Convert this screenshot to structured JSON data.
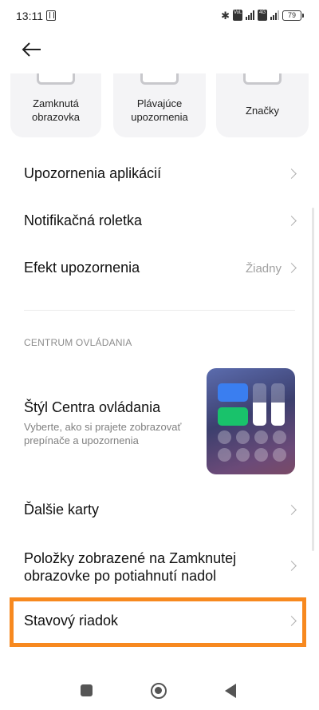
{
  "status_bar": {
    "time": "13:11",
    "sim1_badge": "VoLTE",
    "sim2_badge": "4G",
    "battery": "79",
    "icons": [
      "nfc-icon",
      "bluetooth-icon",
      "signal-icon",
      "battery-icon"
    ]
  },
  "cards": [
    {
      "label": "Zamknutá obrazovka"
    },
    {
      "label": "Plávajúce upozornenia"
    },
    {
      "label": "Značky"
    }
  ],
  "settings": {
    "app_notifications": "Upozornenia aplikácií",
    "notification_shade": "Notifikačná roletka",
    "notification_effect": "Efekt upozornenia",
    "notification_effect_value": "Žiadny"
  },
  "control_center": {
    "section_header": "CENTRUM OVLÁDANIA",
    "style_title": "Štýl Centra ovládania",
    "style_subtitle": "Vyberte, ako si prajete zobrazovať prepínače a upozornenia",
    "more_tiles": "Ďalšie karty",
    "lockscreen_items": "Položky zobrazené na Zamknutej obrazovke po potiahnutí nadol",
    "status_bar": "Stavový riadok"
  },
  "colors": {
    "highlight": "#f7891f",
    "tile_blue": "#3a7ef0",
    "tile_green": "#19c26b"
  }
}
